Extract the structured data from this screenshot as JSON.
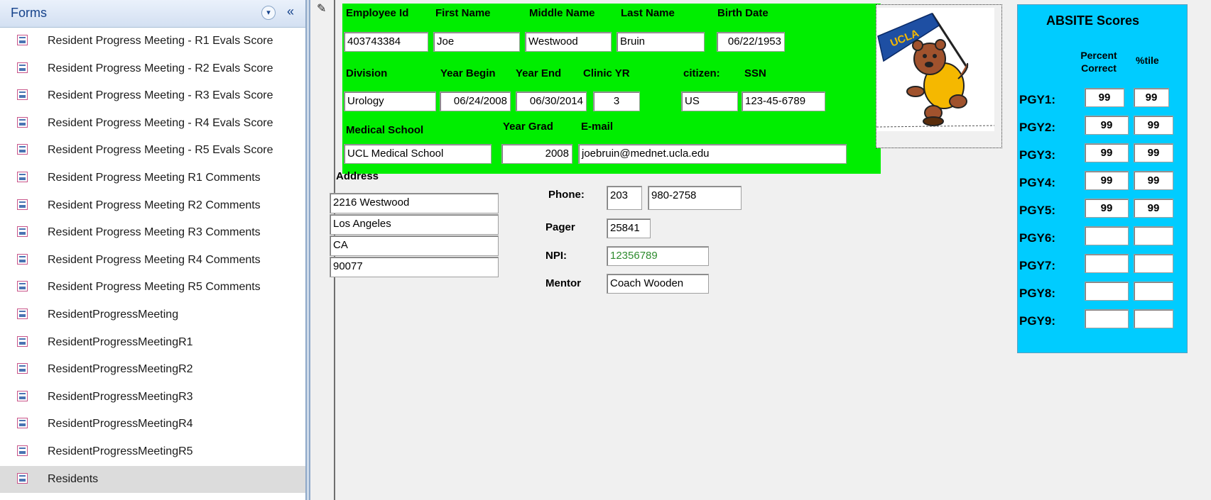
{
  "nav": {
    "title": "Forms",
    "menu_glyph": "▾",
    "collapse_glyph": "«",
    "items": [
      {
        "label": "Resident Progress Meeting - R1 Evals Score"
      },
      {
        "label": "Resident Progress Meeting - R2 Evals Score"
      },
      {
        "label": "Resident Progress Meeting - R3 Evals Score"
      },
      {
        "label": "Resident Progress Meeting - R4 Evals Score"
      },
      {
        "label": "Resident Progress Meeting - R5 Evals Score"
      },
      {
        "label": "Resident Progress Meeting R1 Comments"
      },
      {
        "label": "Resident Progress Meeting R2 Comments"
      },
      {
        "label": "Resident Progress Meeting R3 Comments"
      },
      {
        "label": "Resident Progress Meeting R4 Comments"
      },
      {
        "label": "Resident Progress Meeting R5 Comments"
      },
      {
        "label": "ResidentProgressMeeting"
      },
      {
        "label": "ResidentProgressMeetingR1"
      },
      {
        "label": "ResidentProgressMeetingR2"
      },
      {
        "label": "ResidentProgressMeetingR3"
      },
      {
        "label": "ResidentProgressMeetingR4"
      },
      {
        "label": "ResidentProgressMeetingR5"
      },
      {
        "label": "Residents",
        "selected": true
      }
    ]
  },
  "record": {
    "edit_glyph": "✎",
    "labels": {
      "employee_id": "Employee Id",
      "first_name": "First Name",
      "middle_name": "Middle Name",
      "last_name": "Last Name",
      "birth_date": "Birth Date",
      "division": "Division",
      "year_begin": "Year Begin",
      "year_end": "Year End",
      "clinic_yr": "Clinic YR",
      "citizen": "citizen:",
      "ssn": "SSN",
      "medical_school": "Medical School",
      "year_grad": "Year Grad",
      "email": "E-mail",
      "address": "Address",
      "phone": "Phone:",
      "pager": "Pager",
      "npi": "NPI:",
      "mentor": "Mentor"
    },
    "values": {
      "employee_id": "403743384",
      "first_name": "Joe",
      "middle_name": "Westwood",
      "last_name": "Bruin",
      "birth_date": "06/22/1953",
      "division": "Urology",
      "year_begin": "06/24/2008",
      "year_end": "06/30/2014",
      "clinic_yr": "3",
      "citizen": "US",
      "ssn": "123-45-6789",
      "medical_school": "UCL Medical School",
      "year_grad": "2008",
      "email": "joebruin@mednet.ucla.edu",
      "address1": "2216 Westwood",
      "address2": "Los Angeles",
      "address3": "CA",
      "address4": "90077",
      "phone_area": "203",
      "phone_number": "980-2758",
      "pager": "25841",
      "npi": "12356789",
      "mentor": "Coach Wooden"
    }
  },
  "mascot": {
    "pennant_text": "UCLA",
    "colors": {
      "fur": "#a0522d",
      "shirt": "#f5b800",
      "pennant": "#1e4fa3"
    }
  },
  "absite": {
    "title": "ABSITE Scores",
    "col_percent": "Percent Correct",
    "col_tile": "%tile",
    "rows": [
      {
        "label": "PGY1:",
        "percent": "99",
        "tile": "99"
      },
      {
        "label": "PGY2:",
        "percent": "99",
        "tile": "99"
      },
      {
        "label": "PGY3:",
        "percent": "99",
        "tile": "99"
      },
      {
        "label": "PGY4:",
        "percent": "99",
        "tile": "99"
      },
      {
        "label": "PGY5:",
        "percent": "99",
        "tile": "99"
      },
      {
        "label": "PGY6:",
        "percent": "",
        "tile": ""
      },
      {
        "label": "PGY7:",
        "percent": "",
        "tile": ""
      },
      {
        "label": "PGY8:",
        "percent": "",
        "tile": ""
      },
      {
        "label": "PGY9:",
        "percent": "",
        "tile": ""
      }
    ]
  },
  "colors": {
    "green_panel": "#00ee00",
    "blue_panel": "#00ccff",
    "npi_text": "#2e8b2e",
    "nav_header_text": "#15428b"
  }
}
